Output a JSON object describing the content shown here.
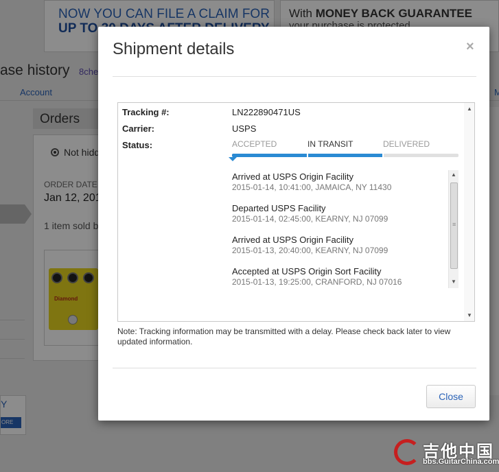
{
  "background": {
    "banner_left_line1": "NOW YOU CAN FILE A CLAIM FOR",
    "banner_left_line2": "UP TO 30 DAYS AFTER DELIVERY",
    "banner_right_prefix": "With",
    "banner_right_bold": "MONEY BACK GUARANTEE",
    "banner_right_line2": "your purchase is protected",
    "page_heading": "ase history",
    "username": "8che",
    "account_link": "Account",
    "orders_tab": "Orders",
    "radio_label": "Not hidd",
    "order_date_label": "ORDER DATE",
    "order_date_value": "Jan 12, 201",
    "items_sold": "1 item sold b",
    "pedal_brand": "Diamond",
    "promo_letter": "Y",
    "promo_button": "ORE"
  },
  "modal": {
    "title": "Shipment details",
    "close_icon": "×",
    "tracking_label": "Tracking #:",
    "tracking_value": "LN222890471US",
    "carrier_label": "Carrier:",
    "carrier_value": "USPS",
    "status_label": "Status:",
    "steps": [
      "ACCEPTED",
      "IN TRANSIT",
      "DELIVERED"
    ],
    "current_step": "IN TRANSIT",
    "progress_fraction": 0.67,
    "events": [
      {
        "title": "Arrived at USPS Origin Facility",
        "detail": "2015-01-14, 10:41:00, JAMAICA, NY 11430"
      },
      {
        "title": "Departed USPS Facility",
        "detail": "2015-01-14, 02:45:00, KEARNY, NJ 07099"
      },
      {
        "title": "Arrived at USPS Origin Facility",
        "detail": "2015-01-13, 20:40:00, KEARNY, NJ 07099"
      },
      {
        "title": "Accepted at USPS Origin Sort Facility",
        "detail": "2015-01-13, 19:25:00, CRANFORD, NJ 07016"
      }
    ],
    "note": "Note: Tracking information may be transmitted with a delay. Please check back later to view updated information.",
    "close_button": "Close"
  },
  "watermark": {
    "text": "吉他中国",
    "url": "bbs.GuitarChina.com"
  },
  "colors": {
    "accent": "#2a8ad3",
    "link": "#2b63b8",
    "overlay": "#000000"
  }
}
